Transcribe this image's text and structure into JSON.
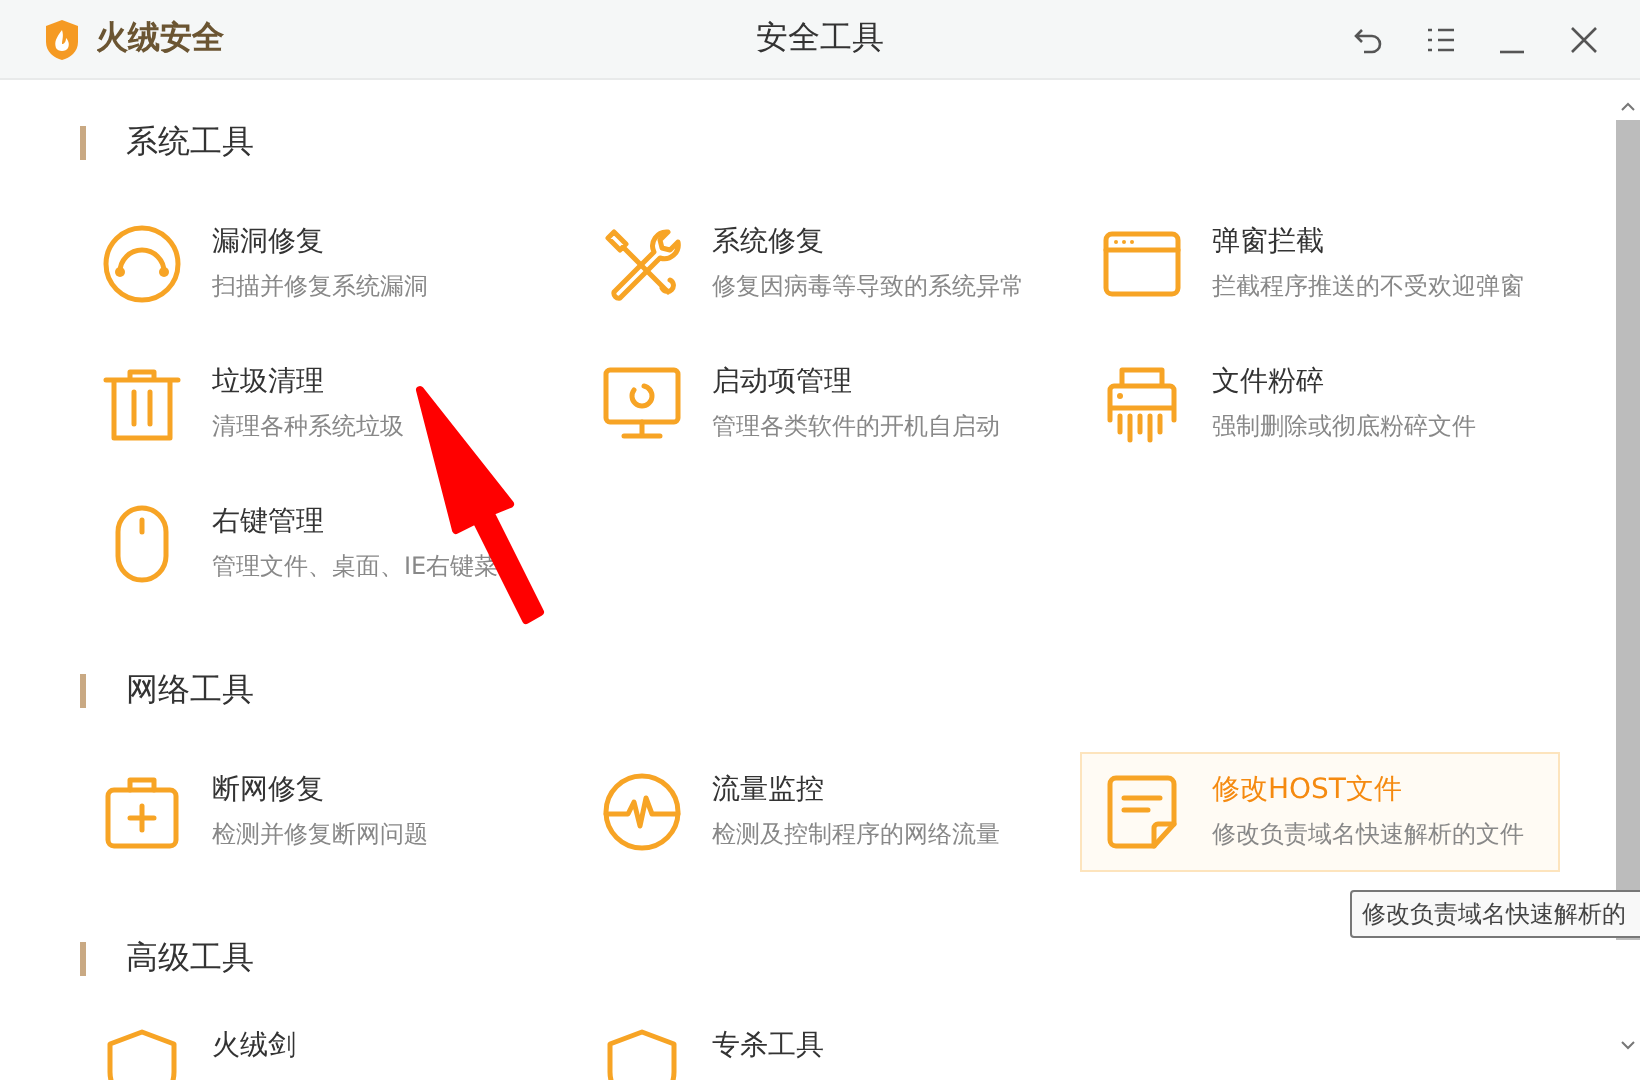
{
  "window": {
    "logo_text": "火绒安全",
    "title": "安全工具"
  },
  "sections": [
    {
      "title": "系统工具",
      "items": [
        {
          "kind": "scan",
          "title": "漏洞修复",
          "description": "扫描并修复系统漏洞",
          "highlighted": false
        },
        {
          "kind": "tools",
          "title": "系统修复",
          "description": "修复因病毒等导致的系统异常",
          "highlighted": false
        },
        {
          "kind": "popup",
          "title": "弹窗拦截",
          "description": "拦截程序推送的不受欢迎弹窗",
          "highlighted": false
        },
        {
          "kind": "trash",
          "title": "垃圾清理",
          "description": "清理各种系统垃圾",
          "highlighted": false
        },
        {
          "kind": "monitor",
          "title": "启动项管理",
          "description": "管理各类软件的开机自启动",
          "highlighted": false
        },
        {
          "kind": "shredder",
          "title": "文件粉碎",
          "description": "强制删除或彻底粉碎文件",
          "highlighted": false
        },
        {
          "kind": "mouse",
          "title": "右键管理",
          "description": "管理文件、桌面、IE右键菜",
          "highlighted": false
        }
      ]
    },
    {
      "title": "网络工具",
      "items": [
        {
          "kind": "kit",
          "title": "断网修复",
          "description": "检测并修复断网问题",
          "highlighted": false
        },
        {
          "kind": "pulse",
          "title": "流量监控",
          "description": "检测及控制程序的网络流量",
          "highlighted": false
        },
        {
          "kind": "note",
          "title": "修改HOST文件",
          "description": "修改负责域名快速解析的文件",
          "highlighted": true
        }
      ]
    },
    {
      "title": "高级工具",
      "items": [
        {
          "kind": "shield",
          "title": "火绒剑",
          "highlighted": false
        },
        {
          "kind": "shield",
          "title": "专杀工具",
          "highlighted": false
        }
      ]
    }
  ],
  "tooltip": {
    "text": "修改负责域名快速解析的"
  },
  "annotation": {
    "kind": "arrow"
  }
}
